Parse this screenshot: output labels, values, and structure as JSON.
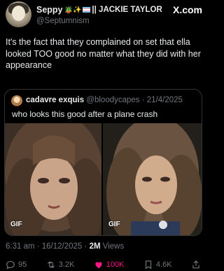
{
  "author": {
    "display_name": "Seppy",
    "emojis": "🪴✨",
    "name_extra": "|| JACKIE TAYLOR",
    "handle": "@Septumnism",
    "platform_logo": "X.com"
  },
  "post": {
    "text": "It's the fact that they complained on set that ella looked TOO good no matter what they did with her appearance"
  },
  "quote": {
    "name": "cadavre exquis",
    "handle_date": "@bloodycapes · 21/4/2025",
    "text": "who looks this good after a plane crash",
    "media": [
      {
        "badge": "GIF"
      },
      {
        "badge": "GIF"
      }
    ]
  },
  "meta": {
    "time_date": "6:31 am · 16/12/2025 · ",
    "views_count": "2M",
    "views_label": " Views"
  },
  "actions": {
    "replies": "95",
    "reposts": "3.2K",
    "likes": "100K",
    "bookmarks": "4.6K"
  },
  "colors": {
    "background": "#000000",
    "text": "#e7e9ea",
    "secondary": "#71767b",
    "like": "#f91880",
    "border": "#2f3336"
  }
}
